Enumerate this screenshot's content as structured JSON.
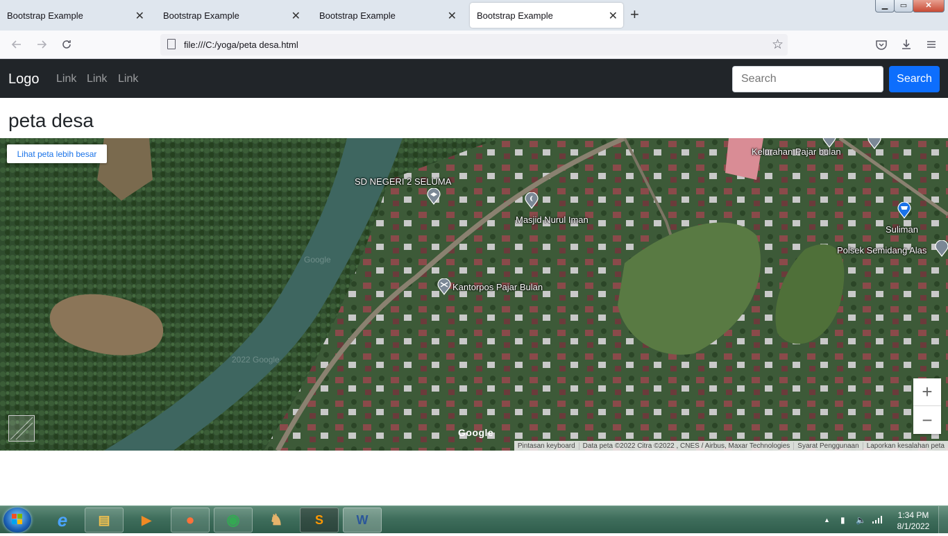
{
  "browser": {
    "tabs": [
      {
        "title": "Bootstrap Example",
        "close": "✕"
      },
      {
        "title": "Bootstrap Example",
        "close": "✕"
      },
      {
        "title": "Bootstrap Example",
        "close": "✕"
      },
      {
        "title": "Bootstrap Example",
        "close": "✕"
      }
    ],
    "new_tab_symbol": "+",
    "url": "file:///C:/yoga/peta desa.html",
    "window_controls": {
      "minimize": "▁",
      "maximize": "▭",
      "close": "✕"
    },
    "icons": {
      "back": "back-arrow-icon",
      "forward": "forward-arrow-icon",
      "reload": "reload-icon",
      "page": "page-icon",
      "bookmark": "star-icon",
      "pocket": "pocket-icon",
      "downloads": "download-icon",
      "menu": "hamburger-menu-icon"
    }
  },
  "site": {
    "brand": "Logo",
    "links": [
      "Link",
      "Link",
      "Link"
    ],
    "search_placeholder": "Search",
    "search_button": "Search",
    "heading": "peta desa"
  },
  "map": {
    "larger_map_button": "Lihat peta lebih besar",
    "places": [
      {
        "label": "SD NEGERI 2 SELUMA",
        "icon": "school-pin-icon"
      },
      {
        "label": "Masjid Nurul Iman",
        "icon": "mosque-pin-icon"
      },
      {
        "label": "Kelurahan Pajar bulan",
        "icon": "government-pin-icon"
      },
      {
        "label": "Suliman",
        "icon": "shopping-pin-icon"
      },
      {
        "label": "Polsek Semidang Alas",
        "icon": "police-pin-icon"
      },
      {
        "label": "Kantorpos Pajar Bulan",
        "icon": "post-office-pin-icon"
      }
    ],
    "zoom_in": "+",
    "zoom_out": "−",
    "google_logo": "Google",
    "watermarks": [
      "Google",
      "2022 Google"
    ],
    "attribution": [
      "Pintasan keyboard",
      "Data peta ©2022 Citra ©2022 , CNES / Airbus, Maxar Technologies",
      "Syarat Penggunaan",
      "Laporkan kesalahan peta"
    ]
  },
  "taskbar": {
    "apps": [
      {
        "name": "internet-explorer",
        "glyph": "e"
      },
      {
        "name": "file-explorer",
        "glyph": "▤"
      },
      {
        "name": "media-player",
        "glyph": "▶"
      },
      {
        "name": "firefox",
        "glyph": "●"
      },
      {
        "name": "chrome",
        "glyph": "◉"
      },
      {
        "name": "game",
        "glyph": "♞"
      },
      {
        "name": "sublime-text",
        "glyph": "S"
      },
      {
        "name": "microsoft-word",
        "glyph": "W"
      }
    ],
    "tray": {
      "show_hidden": "▲",
      "time": "1:34 PM",
      "date": "8/1/2022"
    }
  },
  "colors": {
    "navbar_bg": "#212529",
    "search_button_bg": "#0d6efd",
    "link_blue": "#1a73e8"
  }
}
